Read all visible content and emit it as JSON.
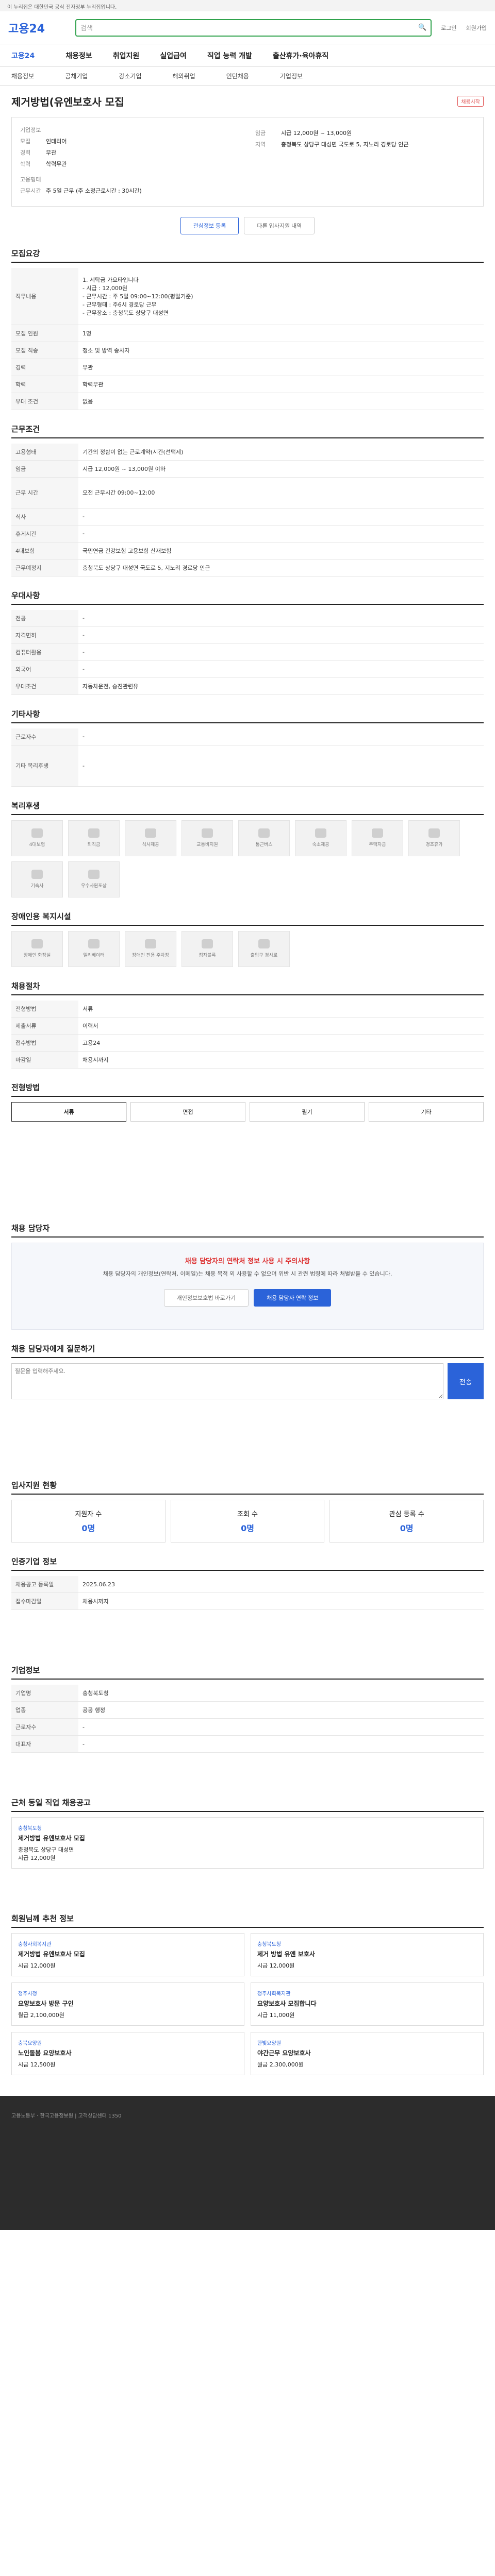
{
  "topbar": "이 누리집은 대한민국 공식 전자정부 누리집입니다.",
  "header": {
    "logo": "고용24",
    "util": [
      "로그인",
      "회원가입"
    ],
    "search_placeholder": "검색"
  },
  "gnb": [
    "채용정보",
    "취업지원",
    "실업급여",
    "직업 능력 개발",
    "출산휴가·육아휴직"
  ],
  "snb": [
    "채용정보",
    "공채기업",
    "강소기업",
    "해외취업",
    "인턴채용",
    "기업정보"
  ],
  "job": {
    "title": "제거방법(유엔보호사 모집",
    "badge": "채용시작",
    "company_label": "기업정보",
    "type_label": "고용형태",
    "rows": [
      [
        "모집",
        "인테리어"
      ],
      [
        "경력",
        "무관"
      ],
      [
        "학력",
        "학력무관"
      ]
    ],
    "right": [
      [
        "임금",
        "시급 12,000원 ~ 13,000원"
      ],
      [
        "지역",
        "충청북도 상당구 대성면 국도로 5, 지노리 경로당 인근"
      ]
    ],
    "wt": [
      "근무시간",
      "주 5일 근무 (주 소정근로시간 : 30시간)"
    ]
  },
  "actions": [
    "관심정보 등록",
    "다른 입사지원 내역"
  ],
  "recruit": {
    "h": "모집요강",
    "rows": [
      [
        "직무내용",
        "1. 세탁금 가요타입니다\n- 시급 : 12,000원\n- 근무시간 : 주 5일 09:00~12:00(평일기준)\n- 근무형태 : 주6시 경로당 근무\n- 근무장소 : 충청북도 상당구 대성면"
      ],
      [
        "모집 인원",
        "1명"
      ],
      [
        "모집 직종",
        "청소 및 방역 종사자"
      ],
      [
        "경력",
        "무관"
      ],
      [
        "학력",
        "학력무관"
      ],
      [
        "우대 조건",
        "없음"
      ]
    ]
  },
  "cond": {
    "h": "근무조건",
    "rows": [
      [
        "고용형태",
        "기간의 정함이 없는 근로계약(시간(선택제)"
      ],
      [
        "임금",
        "시급 12,000원 ~ 13,000원 이하"
      ],
      [
        "근무 시간",
        "오전 근무시간 09:00~12:00"
      ],
      [
        "식사",
        "-"
      ],
      [
        "휴게시간",
        "-"
      ],
      [
        "4대보험",
        "국민연금 건강보험 고용보험 산재보험"
      ],
      [
        "근무예정지",
        "충청북도 상당구 대성면 국도로 5, 지노리 경로당 인근"
      ]
    ]
  },
  "qual": {
    "h": "우대사항",
    "rows": [
      [
        "전공",
        "-"
      ],
      [
        "자격면허",
        "-"
      ],
      [
        "컴퓨터활용",
        "-"
      ],
      [
        "외국어",
        "-"
      ],
      [
        "우대조건",
        "자동차운전, 승진관련유"
      ]
    ]
  },
  "other": {
    "h": "기타사항",
    "rows": [
      [
        "근로자수",
        "-"
      ],
      [
        "기타 복리후생",
        "-"
      ]
    ]
  },
  "welfare": {
    "h": "복리후생",
    "items": [
      "4대보험",
      "퇴직금",
      "식사제공",
      "교통비지원",
      "통근버스",
      "숙소제공",
      "주택자금",
      "경조휴가",
      "기숙사",
      "우수사원포상"
    ]
  },
  "disable": {
    "h": "장애인용 복지시설",
    "items": [
      "장애인 화장실",
      "엘리베이터",
      "장애인 전용 주차장",
      "점자블록",
      "출입구 경사로"
    ]
  },
  "proc": {
    "h": "채용절차",
    "rows": [
      [
        "전형방법",
        "서류"
      ],
      [
        "제출서류",
        "이력서"
      ],
      [
        "접수방법",
        "고용24"
      ],
      [
        "마감일",
        "채용시까지"
      ]
    ]
  },
  "apply": {
    "h": "전형방법",
    "tabs": [
      "서류",
      "면접",
      "필기",
      "기타"
    ]
  },
  "manager": {
    "h": "채용 담당자",
    "alert": "채용 담당자의 연락처 정보 사용 시 주의사항",
    "desc": "채용 담당자의 개인정보(연락처, 이메일)는 채용 목적 외 사용할 수 없으며 위반 시 관련 법령에 따라 처벌받을 수 있습니다.",
    "b1": "개인정보보호법 바로가기",
    "b2": "채용 담당자 연락 정보"
  },
  "ask": {
    "h": "채용 담당자에게 질문하기",
    "ph": "질문을 입력해주세요.",
    "btn": "전송"
  },
  "stat": {
    "h": "입사지원 현황",
    "cells": [
      [
        "지원자 수",
        "0명"
      ],
      [
        "조회 수",
        "0명"
      ],
      [
        "관심 등록 수",
        "0명"
      ]
    ]
  },
  "reginfo": {
    "h": "인증기업 정보",
    "rows": [
      [
        "채용공고 등록일",
        "2025.06.23"
      ],
      [
        "접수마감일",
        "채용시까지"
      ]
    ]
  },
  "company": {
    "h": "기업정보",
    "rows": [
      [
        "기업명",
        "충청북도청"
      ],
      [
        "업종",
        "공공 행정"
      ],
      [
        "근로자수",
        "-"
      ],
      [
        "대표자",
        "-"
      ]
    ]
  },
  "nearby": {
    "h": "근처 동일 직업 채용공고",
    "cards": [
      {
        "co": "충청북도청",
        "t": "제거방법 유엔보호사 모집",
        "d": "충청북도 상당구 대성면",
        "w": "시급 12,000원"
      }
    ]
  },
  "recommend": {
    "h": "회원님께 추천 정보",
    "cards": [
      {
        "co": "충청사회복지관",
        "t": "제거방법 유엔보호사 모집",
        "w": "시급 12,000원"
      },
      {
        "co": "충청북도청",
        "t": "제거 방법 유엔 보호사",
        "w": "시급 12,000원"
      },
      {
        "co": "청주시청",
        "t": "요양보호사 방문 구인",
        "w": "월급 2,100,000원"
      },
      {
        "co": "청주사회복지관",
        "t": "요양보호사 모집합니다",
        "w": "시급 11,000원"
      },
      {
        "co": "충북요양원",
        "t": "노인돌봄 요양보호사",
        "w": "시급 12,500원"
      },
      {
        "co": "한빛요양원",
        "t": "야간근무 요양보호사",
        "w": "월급 2,300,000원"
      }
    ]
  },
  "footer": "고용노동부 · 한국고용정보원 | 고객상담센터 1350"
}
